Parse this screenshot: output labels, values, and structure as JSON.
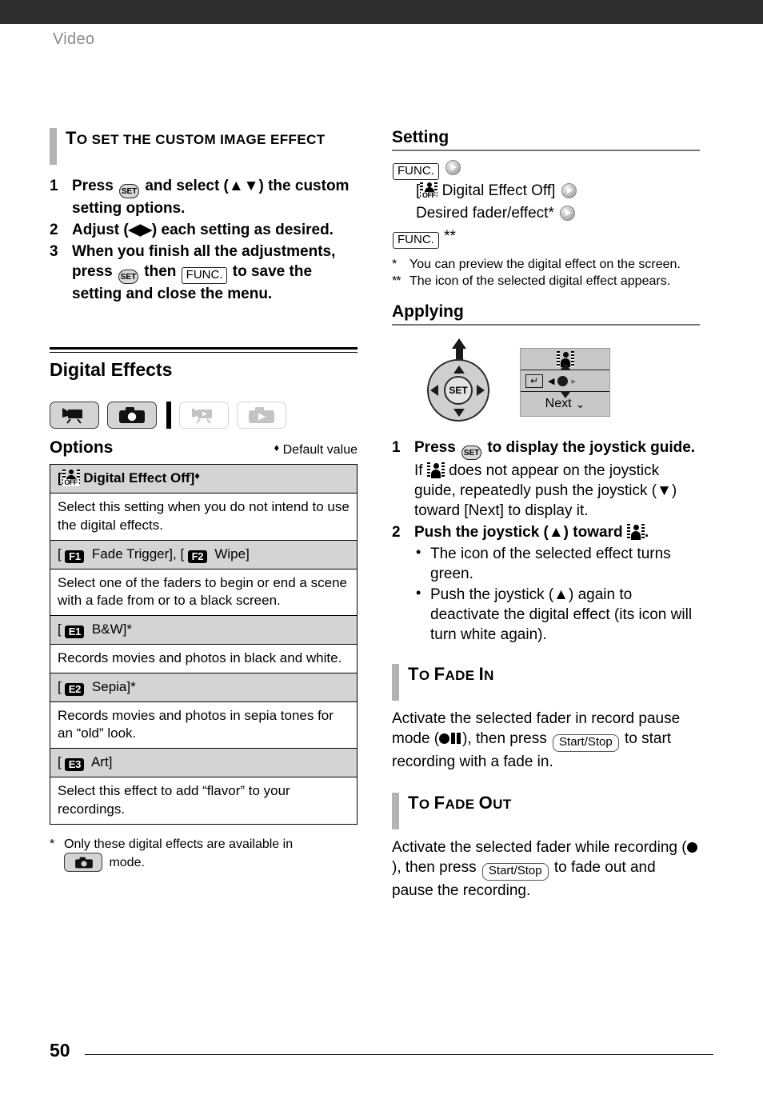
{
  "header": {
    "running_head": "Video"
  },
  "left": {
    "custom_effect": {
      "heading": "To set the custom image effect",
      "steps": [
        {
          "num": "1",
          "text_before": "Press",
          "btn1": "SET",
          "text_mid": "and select (▲▼) the custom setting options."
        },
        {
          "num": "2",
          "text_before": "Adjust (◀▶) each setting as desired."
        },
        {
          "num": "3",
          "text_before": "When you finish all the adjustments, press",
          "btn1": "SET",
          "text_mid": "then",
          "btn2": "FUNC.",
          "text_after": "to save the setting and close the menu."
        }
      ]
    },
    "section": {
      "title": "Digital Effects",
      "modes": [
        {
          "name": "movie-record-mode",
          "state": "on"
        },
        {
          "name": "photo-record-mode",
          "state": "on"
        },
        {
          "name": "movie-playback-mode",
          "state": "off"
        },
        {
          "name": "photo-playback-mode",
          "state": "off"
        }
      ],
      "options_label": "Options",
      "default_note": "Default value",
      "default_marker": "♦"
    },
    "options_table": [
      {
        "icon": "digital-effect-off-icon",
        "label_open": "[",
        "label": "Digital Effect Off]",
        "marker": "♦",
        "bold": true,
        "desc": "Select this setting when you do not intend to use the digital effects."
      },
      {
        "badges": [
          "F1",
          "F2"
        ],
        "label_a": "Fade Trigger],",
        "label_b": "Wipe]",
        "bold": false,
        "desc": "Select one of the faders to begin or end a scene with a fade from or to a black screen."
      },
      {
        "badge": "E1",
        "label": "B&W]*",
        "bold": false,
        "desc": "Records movies and photos in black and white."
      },
      {
        "badge": "E2",
        "label": "Sepia]*",
        "bold": false,
        "desc": "Records movies and photos in sepia tones for an “old” look."
      },
      {
        "badge": "E3",
        "label": "Art]",
        "bold": false,
        "desc": "Select this effect to add “flavor” to your recordings."
      }
    ],
    "footnote": {
      "marker": "*",
      "text_before": "Only these digital effects are available in",
      "text_after": "mode."
    }
  },
  "right": {
    "setting": {
      "title": "Setting",
      "flow_line1_btn": "FUNC.",
      "flow_line2_label": "Digital Effect Off]",
      "flow_line2_open": "[",
      "flow_line3_label": "Desired fader/effect*",
      "flow_line4_btn": "FUNC.",
      "flow_line4_marks": "**",
      "notes": [
        {
          "marker": "*",
          "text": "You can preview the digital effect on the screen."
        },
        {
          "marker": "**",
          "text": "The icon of the selected digital effect appears."
        }
      ]
    },
    "applying": {
      "title": "Applying",
      "joystick_label": "SET",
      "guide": {
        "top_icon": "digital-effect-icon",
        "return_icon": "↵",
        "next_label": "Next",
        "chevron": "⌄"
      },
      "steps": [
        {
          "num": "1",
          "text_before": "Press",
          "btn1": "SET",
          "text_mid": "to display the joystick guide.",
          "sub_before": "If",
          "sub_after": "does not appear on the joystick guide, repeatedly push the joystick (▼) toward [Next] to display it."
        },
        {
          "num": "2",
          "text_before": "Push the joystick (▲) toward",
          "text_after": ".",
          "bullets": [
            "The icon of the selected effect turns green.",
            "Push the joystick (▲) again to deactivate the digital effect (its icon will turn white again)."
          ]
        }
      ]
    },
    "fade_in": {
      "heading": "To Fade In",
      "text_before": "Activate the selected fader in record pause mode (",
      "text_mid": "), then press",
      "button": "Start/Stop",
      "text_after": "to start recording with a fade in."
    },
    "fade_out": {
      "heading": "To Fade Out",
      "text_before": "Activate the selected fader while recording (",
      "text_mid": "), then press",
      "button": "Start/Stop",
      "text_after": "to fade out and pause the recording."
    }
  },
  "footer": {
    "page_number": "50"
  }
}
